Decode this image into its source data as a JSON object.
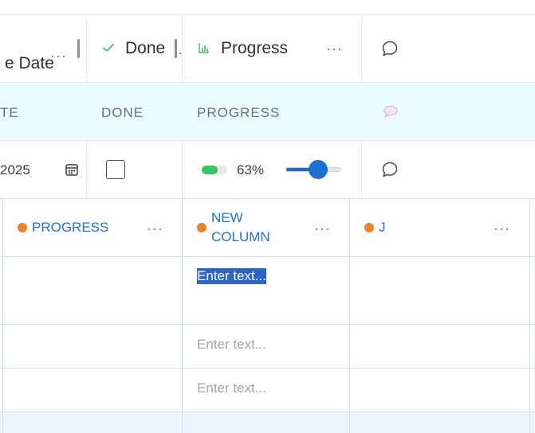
{
  "top_table": {
    "columns": [
      {
        "title": "e Date",
        "dots": "···"
      },
      {
        "title": "Done",
        "dots": "·"
      },
      {
        "title": "Progress",
        "dots": "···"
      }
    ],
    "subheaders": [
      "TE",
      "DONE",
      "PROGRESS"
    ],
    "row": {
      "date_value": "2025",
      "done_checked": false,
      "progress_percent": 63,
      "progress_label": "63%",
      "slider_value": 0.58
    }
  },
  "lower_grid": {
    "columns": [
      {
        "title": "PROGRESS",
        "dots": "···"
      },
      {
        "title": "NEW COLUMN",
        "dots": "···"
      },
      {
        "title": "J",
        "dots": "···"
      }
    ],
    "cells": {
      "row1_new_column": "Enter text...",
      "row2_new_column": "Enter text...",
      "row3_new_column": "Enter text..."
    }
  },
  "colors": {
    "accent_blue": "#1f6fd6",
    "status_orange": "#f47f2a",
    "progress_green": "#3cc36a",
    "subheader_bg": "#eafcfd"
  },
  "icons": [
    "check-icon",
    "bar-chart-icon",
    "comment-icon",
    "speech-bubble-emoji-icon",
    "calendar-icon"
  ]
}
